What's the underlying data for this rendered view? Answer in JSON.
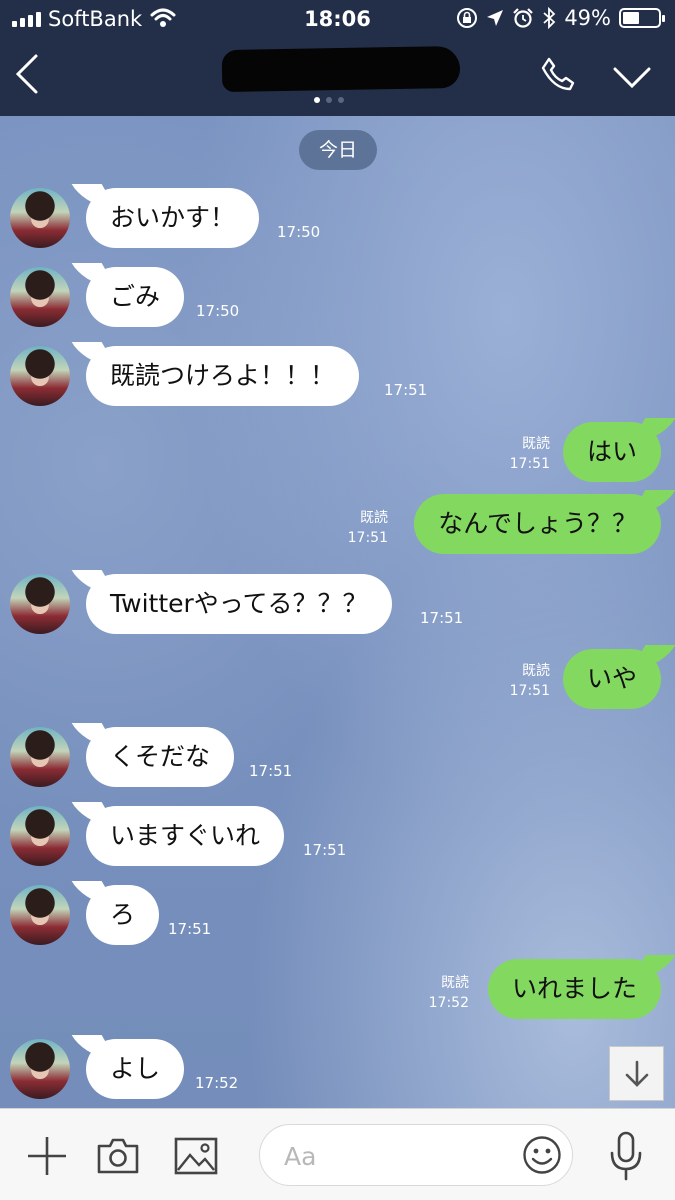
{
  "status_bar": {
    "carrier": "SoftBank",
    "time": "18:06",
    "battery": "49%"
  },
  "chat": {
    "date_divider": "今日",
    "messages": [
      {
        "side": "in",
        "text": "おいかす！",
        "time": "17:50"
      },
      {
        "side": "in",
        "text": "ごみ",
        "time": "17:50"
      },
      {
        "side": "in",
        "text": "既読つけろよ！！！",
        "time": "17:51"
      },
      {
        "side": "out",
        "text": "はい",
        "time": "17:51",
        "read": "既読"
      },
      {
        "side": "out",
        "text": "なんでしょう？？",
        "time": "17:51",
        "read": "既読"
      },
      {
        "side": "in",
        "text": "Twitterやってる？？？",
        "time": "17:51"
      },
      {
        "side": "out",
        "text": "いや",
        "time": "17:51",
        "read": "既読"
      },
      {
        "side": "in",
        "text": "くそだな",
        "time": "17:51"
      },
      {
        "side": "in",
        "text": "いますぐいれ",
        "time": "17:51"
      },
      {
        "side": "in",
        "text": "ろ",
        "time": "17:51"
      },
      {
        "side": "out",
        "text": "いれました",
        "time": "17:52",
        "read": "既読"
      },
      {
        "side": "in",
        "text": "よし",
        "time": "17:52"
      }
    ]
  },
  "input": {
    "placeholder": "Aa"
  },
  "colors": {
    "header_bg": "#232f49",
    "chat_bg": "#7a93c0",
    "outgoing_bubble": "#83d85f",
    "incoming_bubble": "#ffffff"
  },
  "icons": [
    "back-icon",
    "phone-icon",
    "chevron-down-icon",
    "plus-icon",
    "camera-icon",
    "image-icon",
    "emoji-icon",
    "microphone-icon",
    "arrow-down-icon"
  ]
}
